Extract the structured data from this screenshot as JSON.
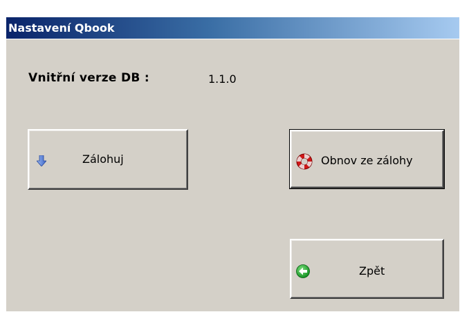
{
  "window": {
    "title": "Nastavení Qbook"
  },
  "db_version": {
    "label": "Vnitřní verze DB :",
    "value": "1.1.0"
  },
  "buttons": {
    "backup": {
      "label": "Zálohuj",
      "icon": "arrow-down-icon"
    },
    "restore": {
      "label": "Obnov ze zálohy",
      "icon": "lifebuoy-icon"
    },
    "back": {
      "label": "Zpět",
      "icon": "back-arrow-icon"
    }
  },
  "colors": {
    "title_gradient_start": "#0a246a",
    "title_gradient_end": "#a6caf0",
    "face": "#d4d0c8"
  }
}
